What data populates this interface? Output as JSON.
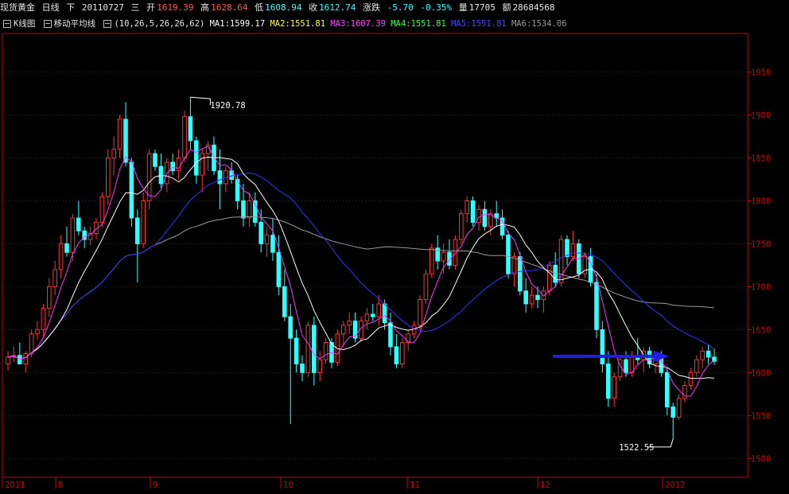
{
  "header": {
    "name": "现货黄金",
    "period": "日线",
    "direction": "下",
    "date": "20110727",
    "weekday": "三",
    "open_label": "开",
    "open": "1619.39",
    "high_label": "高",
    "high": "1628.64",
    "low_label": "低",
    "low": "1608.94",
    "close_label": "收",
    "close": "1612.74",
    "change_label": "涨跌",
    "change": "-5.70",
    "change_pct": "-0.35%",
    "volume_label": "量",
    "volume": "17705",
    "amount_label": "额",
    "amount": "28684568"
  },
  "indicator_bar": {
    "kline_label": "K线图",
    "ma_label": "移动平均线",
    "params": "(10,26,5,26,26,62)",
    "ma1": "MA1:1599.17",
    "ma2": "MA2:1551.81",
    "ma3": "MA3:1607.39",
    "ma4": "MA4:1551.81",
    "ma5": "MA5:1551.81",
    "ma6": "MA6:1534.06"
  },
  "colors": {
    "up": "#ff3333",
    "down": "#33ffff",
    "grid": "#8b0000",
    "axis": "#cc0000",
    "ma1": "#ffffff",
    "ma3": "#ff33ff",
    "ma5": "#3333ff",
    "ma6": "#9a9a9a",
    "arrow": "#1e1ee6"
  },
  "chart_data": {
    "type": "candlestick",
    "x_labels": [
      "2011",
      "8",
      "9",
      "10",
      "11",
      "12",
      "2012"
    ],
    "y_ticks": [
      "1950",
      "1900",
      "1850",
      "1800",
      "1750",
      "1700",
      "1650",
      "1600",
      "1550",
      "1500"
    ],
    "ylim": [
      1478,
      1995
    ],
    "annotations": [
      {
        "text": "1920.78",
        "value": 1920.78,
        "type": "high"
      },
      {
        "text": "1522.55",
        "value": 1522.55,
        "type": "low"
      }
    ],
    "arrow": {
      "from_value": 1619,
      "to_value": 1619,
      "direction": "right"
    },
    "candles": [
      [
        1610,
        1625,
        1602,
        1618
      ],
      [
        1618,
        1630,
        1612,
        1620
      ],
      [
        1620,
        1635,
        1615,
        1610
      ],
      [
        1610,
        1625,
        1600,
        1622
      ],
      [
        1622,
        1650,
        1618,
        1645
      ],
      [
        1645,
        1660,
        1638,
        1650
      ],
      [
        1650,
        1680,
        1640,
        1675
      ],
      [
        1675,
        1710,
        1665,
        1700
      ],
      [
        1700,
        1730,
        1690,
        1720
      ],
      [
        1720,
        1760,
        1710,
        1750
      ],
      [
        1750,
        1770,
        1735,
        1740
      ],
      [
        1740,
        1785,
        1730,
        1780
      ],
      [
        1780,
        1800,
        1760,
        1765
      ],
      [
        1765,
        1770,
        1745,
        1755
      ],
      [
        1755,
        1770,
        1748,
        1762
      ],
      [
        1762,
        1780,
        1755,
        1775
      ],
      [
        1775,
        1810,
        1770,
        1805
      ],
      [
        1805,
        1860,
        1795,
        1850
      ],
      [
        1850,
        1875,
        1830,
        1860
      ],
      [
        1860,
        1900,
        1850,
        1895
      ],
      [
        1895,
        1915,
        1840,
        1845
      ],
      [
        1845,
        1850,
        1770,
        1780
      ],
      [
        1780,
        1790,
        1705,
        1750
      ],
      [
        1750,
        1810,
        1745,
        1800
      ],
      [
        1800,
        1860,
        1790,
        1855
      ],
      [
        1855,
        1860,
        1835,
        1840
      ],
      [
        1840,
        1855,
        1815,
        1820
      ],
      [
        1820,
        1850,
        1810,
        1845
      ],
      [
        1845,
        1855,
        1830,
        1835
      ],
      [
        1835,
        1860,
        1825,
        1850
      ],
      [
        1850,
        1905,
        1845,
        1898
      ],
      [
        1898,
        1921,
        1860,
        1870
      ],
      [
        1870,
        1875,
        1820,
        1830
      ],
      [
        1830,
        1860,
        1810,
        1855
      ],
      [
        1855,
        1870,
        1835,
        1865
      ],
      [
        1865,
        1875,
        1830,
        1835
      ],
      [
        1835,
        1860,
        1790,
        1820
      ],
      [
        1820,
        1840,
        1810,
        1835
      ],
      [
        1835,
        1845,
        1820,
        1825
      ],
      [
        1825,
        1830,
        1790,
        1800
      ],
      [
        1800,
        1820,
        1770,
        1780
      ],
      [
        1780,
        1810,
        1770,
        1800
      ],
      [
        1800,
        1810,
        1770,
        1775
      ],
      [
        1775,
        1790,
        1740,
        1750
      ],
      [
        1750,
        1770,
        1735,
        1760
      ],
      [
        1760,
        1780,
        1730,
        1740
      ],
      [
        1740,
        1760,
        1690,
        1700
      ],
      [
        1700,
        1720,
        1660,
        1665
      ],
      [
        1665,
        1680,
        1540,
        1640
      ],
      [
        1640,
        1650,
        1600,
        1610
      ],
      [
        1610,
        1620,
        1590,
        1600
      ],
      [
        1600,
        1660,
        1595,
        1655
      ],
      [
        1655,
        1665,
        1585,
        1600
      ],
      [
        1600,
        1625,
        1590,
        1615
      ],
      [
        1615,
        1640,
        1610,
        1635
      ],
      [
        1635,
        1640,
        1605,
        1612
      ],
      [
        1612,
        1650,
        1608,
        1645
      ],
      [
        1645,
        1660,
        1630,
        1655
      ],
      [
        1655,
        1670,
        1645,
        1660
      ],
      [
        1660,
        1670,
        1635,
        1640
      ],
      [
        1640,
        1665,
        1635,
        1660
      ],
      [
        1660,
        1675,
        1650,
        1668
      ],
      [
        1668,
        1680,
        1660,
        1665
      ],
      [
        1665,
        1690,
        1655,
        1680
      ],
      [
        1680,
        1685,
        1650,
        1658
      ],
      [
        1658,
        1670,
        1620,
        1630
      ],
      [
        1630,
        1645,
        1605,
        1610
      ],
      [
        1610,
        1640,
        1605,
        1635
      ],
      [
        1635,
        1650,
        1625,
        1645
      ],
      [
        1645,
        1660,
        1640,
        1655
      ],
      [
        1655,
        1690,
        1650,
        1685
      ],
      [
        1685,
        1720,
        1680,
        1715
      ],
      [
        1715,
        1750,
        1710,
        1745
      ],
      [
        1745,
        1760,
        1720,
        1730
      ],
      [
        1730,
        1750,
        1715,
        1740
      ],
      [
        1740,
        1755,
        1720,
        1725
      ],
      [
        1725,
        1760,
        1720,
        1755
      ],
      [
        1755,
        1790,
        1750,
        1785
      ],
      [
        1785,
        1805,
        1775,
        1800
      ],
      [
        1800,
        1805,
        1770,
        1775
      ],
      [
        1775,
        1795,
        1765,
        1790
      ],
      [
        1790,
        1800,
        1765,
        1770
      ],
      [
        1770,
        1790,
        1760,
        1785
      ],
      [
        1785,
        1800,
        1770,
        1780
      ],
      [
        1780,
        1790,
        1755,
        1760
      ],
      [
        1760,
        1765,
        1710,
        1715
      ],
      [
        1715,
        1740,
        1700,
        1735
      ],
      [
        1735,
        1740,
        1690,
        1695
      ],
      [
        1695,
        1710,
        1670,
        1680
      ],
      [
        1680,
        1700,
        1675,
        1690
      ],
      [
        1690,
        1700,
        1675,
        1685
      ],
      [
        1685,
        1700,
        1670,
        1695
      ],
      [
        1695,
        1730,
        1690,
        1725
      ],
      [
        1725,
        1740,
        1700,
        1705
      ],
      [
        1705,
        1760,
        1700,
        1755
      ],
      [
        1755,
        1760,
        1725,
        1735
      ],
      [
        1735,
        1765,
        1730,
        1750
      ],
      [
        1750,
        1755,
        1710,
        1715
      ],
      [
        1715,
        1740,
        1710,
        1735
      ],
      [
        1735,
        1745,
        1700,
        1705
      ],
      [
        1705,
        1715,
        1640,
        1650
      ],
      [
        1650,
        1660,
        1600,
        1610
      ],
      [
        1610,
        1625,
        1560,
        1570
      ],
      [
        1570,
        1600,
        1560,
        1595
      ],
      [
        1595,
        1620,
        1590,
        1615
      ],
      [
        1615,
        1625,
        1595,
        1600
      ],
      [
        1600,
        1625,
        1595,
        1620
      ],
      [
        1620,
        1640,
        1610,
        1615
      ],
      [
        1615,
        1630,
        1600,
        1625
      ],
      [
        1625,
        1630,
        1605,
        1610
      ],
      [
        1610,
        1625,
        1600,
        1620
      ],
      [
        1620,
        1625,
        1595,
        1600
      ],
      [
        1600,
        1605,
        1550,
        1560
      ],
      [
        1560,
        1565,
        1522,
        1548
      ],
      [
        1548,
        1575,
        1545,
        1570
      ],
      [
        1570,
        1590,
        1565,
        1585
      ],
      [
        1585,
        1605,
        1580,
        1600
      ],
      [
        1600,
        1620,
        1595,
        1615
      ],
      [
        1615,
        1630,
        1605,
        1625
      ],
      [
        1625,
        1632,
        1610,
        1618
      ],
      [
        1618,
        1628,
        1609,
        1613
      ]
    ]
  }
}
